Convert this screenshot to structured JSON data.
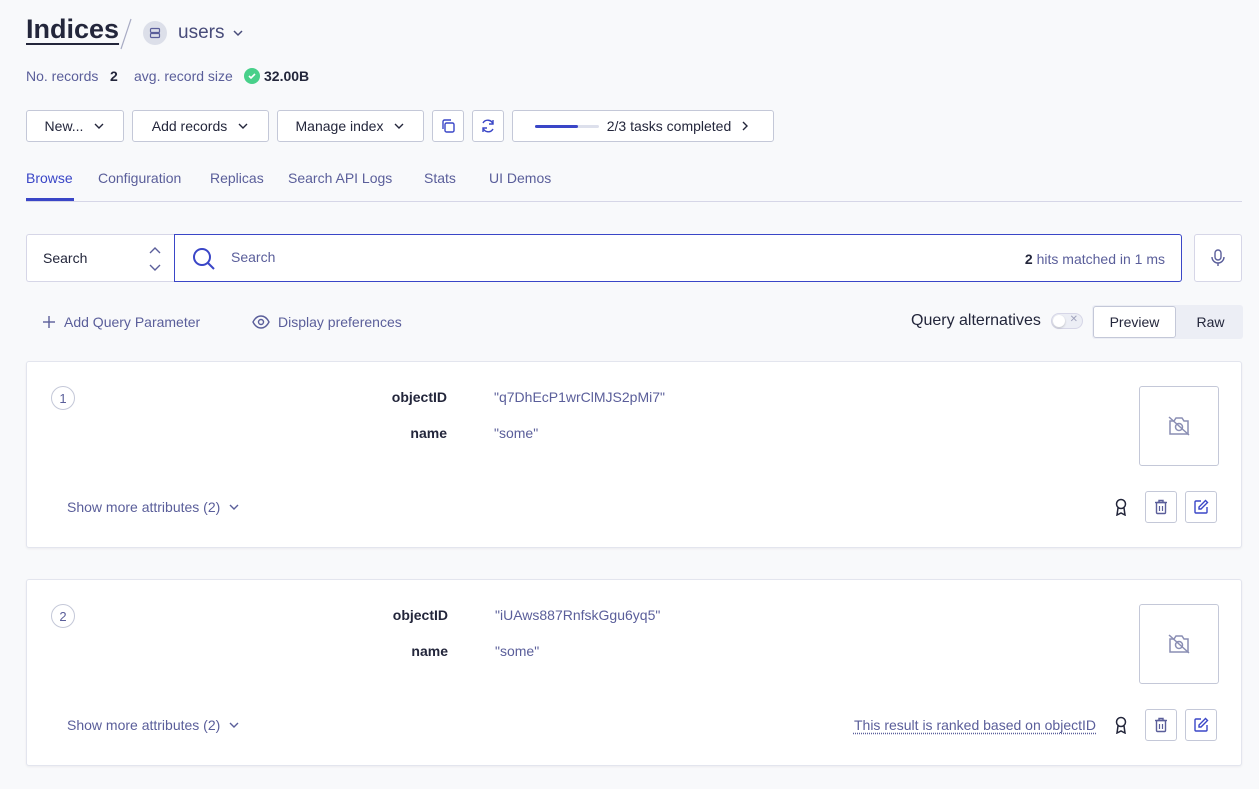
{
  "header": {
    "title": "Indices",
    "index_name": "users",
    "records_label": "No. records",
    "records_value": "2",
    "size_label": "avg. record size",
    "size_value": "32.00B"
  },
  "toolbar": {
    "new_label": "New...",
    "add_records_label": "Add records",
    "manage_index_label": "Manage index",
    "tasks_label": "2/3 tasks completed",
    "tasks_progress": 0.67
  },
  "tabs": [
    {
      "label": "Browse",
      "active": true
    },
    {
      "label": "Configuration",
      "active": false
    },
    {
      "label": "Replicas",
      "active": false
    },
    {
      "label": "Search API Logs",
      "active": false
    },
    {
      "label": "Stats",
      "active": false
    },
    {
      "label": "UI Demos",
      "active": false
    }
  ],
  "search": {
    "mode_label": "Search",
    "placeholder": "Search",
    "hits_count": "2",
    "hits_text": "hits matched in 1 ms"
  },
  "options": {
    "add_param_label": "Add Query Parameter",
    "display_prefs_label": "Display preferences",
    "query_alternatives_label": "Query alternatives",
    "query_alternatives_on": false,
    "view_preview": "Preview",
    "view_raw": "Raw"
  },
  "records": [
    {
      "rank": "1",
      "objectID_key": "objectID",
      "objectID": "\"q7DhEcP1wrClMJS2pMi7\"",
      "name_key": "name",
      "name": "\"some\"",
      "show_more": "Show more attributes (2)",
      "rank_note": ""
    },
    {
      "rank": "2",
      "objectID_key": "objectID",
      "objectID": "\"iUAws887RnfskGgu6yq5\"",
      "name_key": "name",
      "name": "\"some\"",
      "show_more": "Show more attributes (2)",
      "rank_note": "This result is ranked based on objectID"
    }
  ],
  "colors": {
    "accent": "#3a46c7",
    "text": "#23263b",
    "muted": "#5a5e9a",
    "success": "#48d08a"
  },
  "icons": {
    "index": "database-icon",
    "search": "search-icon",
    "mic": "microphone-icon",
    "copy": "copy-icon",
    "refresh": "refresh-icon",
    "plus": "plus-icon",
    "eye": "eye-icon",
    "no_image": "camera-off-icon",
    "award": "award-icon",
    "trash": "trash-icon",
    "edit": "edit-icon"
  }
}
